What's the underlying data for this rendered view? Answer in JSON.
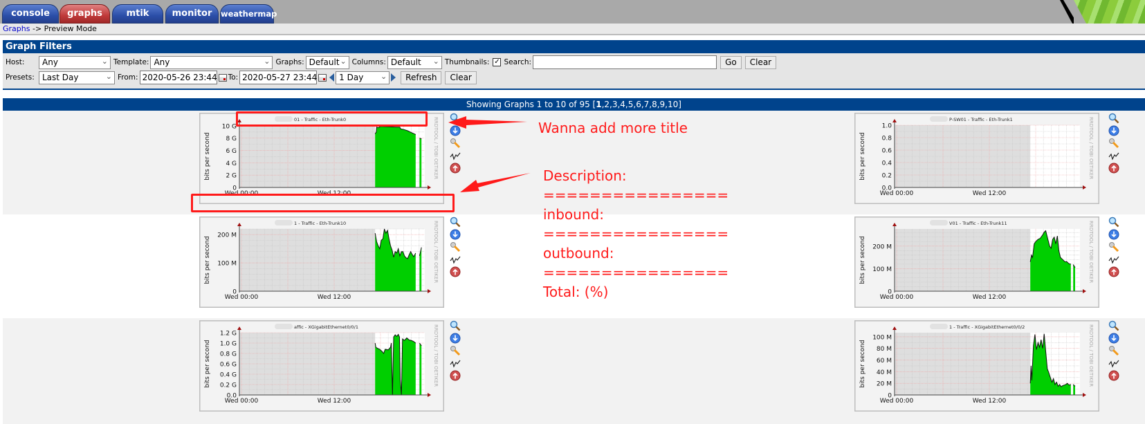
{
  "tabs": [
    {
      "label": "console",
      "active": false
    },
    {
      "label": "graphs",
      "active": true
    },
    {
      "label": "mtik",
      "active": false
    },
    {
      "label": "monitor",
      "active": false
    },
    {
      "label": "weathermap",
      "active": false
    }
  ],
  "breadcrumb": {
    "link": "Graphs",
    "rest": " -> Preview Mode"
  },
  "filters": {
    "title": "Graph Filters",
    "host_label": "Host:",
    "host": "Any",
    "template_label": "Template:",
    "template": "Any",
    "graphs_label": "Graphs:",
    "graphs": "Default",
    "columns_label": "Columns:",
    "columns": "Default",
    "thumbnails_label": "Thumbnails:",
    "thumbnails_checked": true,
    "search_label": "Search:",
    "search_value": "",
    "go": "Go",
    "clear": "Clear",
    "presets_label": "Presets:",
    "preset": "Last Day",
    "from_label": "From:",
    "from": "2020-05-26 23:44",
    "to_label": "To:",
    "to": "2020-05-27 23:44",
    "span": "1 Day",
    "refresh": "Refresh",
    "clear2": "Clear"
  },
  "showing": {
    "text": "Showing Graphs 1 to 10 of 95 [",
    "current": "1",
    "pages": ",2,3,4,5,6,7,8,9,10]"
  },
  "graph_common": {
    "ylabel": "bits per second",
    "watermark": "RRDTOOL / TOBI OETIKER",
    "xticks": [
      {
        "h": 0,
        "label": "Wed 00:00"
      },
      {
        "h": 12,
        "label": "Wed 12:00"
      }
    ],
    "range_hours": [
      -0.27,
      23.73
    ],
    "unknown_until": 17.3,
    "area_color": "#00cf00"
  },
  "graphs": [
    {
      "title": "01 - Traffic - Eth-Trunk0",
      "ymax": 10.1,
      "yticks": [
        [
          0,
          "0"
        ],
        [
          2,
          "2 G"
        ],
        [
          4,
          "4 G"
        ],
        [
          6,
          "6 G"
        ],
        [
          8,
          "8 G"
        ],
        [
          10,
          "10 G"
        ]
      ],
      "minor": 1,
      "series": [
        [
          [
            17.3,
            8.7
          ],
          [
            17.45,
            9.0
          ],
          [
            17.5,
            9.8
          ],
          [
            17.7,
            9.7
          ],
          [
            18,
            9.9
          ],
          [
            19,
            9.85
          ],
          [
            20,
            9.8
          ],
          [
            20.5,
            9.8
          ],
          [
            20.6,
            9.5
          ],
          [
            21,
            9.4
          ],
          [
            21.5,
            9.2
          ],
          [
            22,
            8.9
          ],
          [
            22.55,
            8.6
          ]
        ],
        [
          [
            23.05,
            8.0
          ],
          [
            23.3,
            7.9
          ]
        ]
      ]
    },
    {
      "title": "P-SW01 - Traffic - Eth-Trunk1",
      "ymax": 1.0,
      "yticks": [
        [
          0,
          "0.0"
        ],
        [
          0.2,
          "0.2"
        ],
        [
          0.4,
          "0.4"
        ],
        [
          0.6,
          "0.6"
        ],
        [
          0.8,
          "0.8"
        ],
        [
          1.0,
          "1.0"
        ]
      ],
      "minor": 0.1,
      "series": []
    },
    {
      "title": "1 - Traffic - Eth-Trunk10",
      "ymax": 220,
      "yticks": [
        [
          0,
          "0"
        ],
        [
          100,
          "100 M"
        ],
        [
          200,
          "200 M"
        ]
      ],
      "minor": 20,
      "series": [
        [
          [
            17.3,
            205
          ],
          [
            17.5,
            175
          ],
          [
            17.7,
            160
          ],
          [
            17.9,
            150
          ],
          [
            18.1,
            180
          ],
          [
            18.3,
            185
          ],
          [
            18.5,
            220
          ],
          [
            18.7,
            205
          ],
          [
            18.9,
            215
          ],
          [
            19.1,
            185
          ],
          [
            19.3,
            160
          ],
          [
            19.5,
            145
          ],
          [
            19.7,
            120
          ],
          [
            19.9,
            140
          ],
          [
            20.1,
            135
          ],
          [
            20.3,
            150
          ],
          [
            20.5,
            125
          ],
          [
            20.7,
            140
          ],
          [
            20.9,
            140
          ],
          [
            21.1,
            125
          ],
          [
            21.3,
            118
          ],
          [
            21.5,
            115
          ],
          [
            21.7,
            128
          ],
          [
            21.9,
            140
          ],
          [
            22.1,
            130
          ],
          [
            22.3,
            122
          ],
          [
            22.55,
            135
          ]
        ],
        [
          [
            23.05,
            125
          ],
          [
            23.3,
            155
          ]
        ]
      ]
    },
    {
      "title": "V01 - Traffic - Eth-Trunk11",
      "ymax": 276,
      "yticks": [
        [
          0,
          "0"
        ],
        [
          100,
          "100 M"
        ],
        [
          200,
          "200 M"
        ]
      ],
      "minor": 20,
      "series": [
        [
          [
            17.3,
            130
          ],
          [
            17.45,
            160
          ],
          [
            17.6,
            150
          ],
          [
            17.8,
            210
          ],
          [
            18.0,
            220
          ],
          [
            18.3,
            230
          ],
          [
            18.6,
            235
          ],
          [
            18.9,
            250
          ],
          [
            19.1,
            262
          ],
          [
            19.3,
            268
          ],
          [
            19.5,
            240
          ],
          [
            19.8,
            200
          ],
          [
            20.0,
            190
          ],
          [
            20.2,
            230
          ],
          [
            20.4,
            240
          ],
          [
            20.6,
            210
          ],
          [
            20.8,
            245
          ],
          [
            21.0,
            180
          ],
          [
            21.2,
            150
          ],
          [
            21.5,
            140
          ],
          [
            21.8,
            130
          ],
          [
            22.0,
            132
          ],
          [
            22.3,
            122
          ],
          [
            22.55,
            120
          ]
        ],
        [
          [
            22.85,
            118
          ],
          [
            23.1,
            105
          ]
        ]
      ]
    },
    {
      "title": "affic - XGigabitEthernet0/0/1",
      "ymax": 1.2,
      "yticks": [
        [
          0,
          "0.0"
        ],
        [
          0.2,
          "0.2 G"
        ],
        [
          0.4,
          "0.4 G"
        ],
        [
          0.6,
          "0.6 G"
        ],
        [
          0.8,
          "0.8 G"
        ],
        [
          1.0,
          "1.0 G"
        ],
        [
          1.2,
          "1.2 G"
        ]
      ],
      "minor": 0.1,
      "series": [
        [
          [
            17.3,
            1.0
          ],
          [
            17.4,
            0.92
          ],
          [
            17.6,
            0.9
          ],
          [
            17.9,
            0.88
          ],
          [
            18.2,
            0.84
          ],
          [
            18.4,
            0.8
          ],
          [
            18.6,
            0.88
          ],
          [
            19.0,
            0.87
          ],
          [
            19.3,
            0.92
          ],
          [
            19.4,
            1.0
          ],
          [
            19.55,
            0.0
          ],
          [
            19.7,
            1.12
          ],
          [
            19.9,
            1.16
          ],
          [
            20.1,
            1.13
          ],
          [
            20.3,
            1.17
          ],
          [
            20.45,
            1.12
          ],
          [
            20.55,
            0.3
          ],
          [
            20.7,
            0.0
          ],
          [
            20.85,
            1.08
          ],
          [
            21.1,
            1.05
          ],
          [
            21.4,
            1.1
          ],
          [
            21.7,
            1.06
          ],
          [
            22.0,
            1.05
          ],
          [
            22.3,
            1.03
          ],
          [
            22.55,
            1.0
          ]
        ],
        [
          [
            23.05,
            1.0
          ],
          [
            23.3,
            0.95
          ]
        ]
      ]
    },
    {
      "title": "1 - Traffic - XGigabitEthernet0/0/2",
      "ymax": 107,
      "yticks": [
        [
          0,
          "0"
        ],
        [
          20,
          "20 M"
        ],
        [
          40,
          "40 M"
        ],
        [
          60,
          "60 M"
        ],
        [
          80,
          "80 M"
        ],
        [
          100,
          "100 M"
        ]
      ],
      "minor": 10,
      "series": [
        [
          [
            17.3,
            20
          ],
          [
            17.4,
            50
          ],
          [
            17.5,
            25
          ],
          [
            17.7,
            85
          ],
          [
            17.9,
            104
          ],
          [
            18.1,
            78
          ],
          [
            18.3,
            90
          ],
          [
            18.5,
            82
          ],
          [
            18.7,
            95
          ],
          [
            18.9,
            80
          ],
          [
            19.1,
            105
          ],
          [
            19.3,
            75
          ],
          [
            19.5,
            45
          ],
          [
            19.7,
            38
          ],
          [
            19.9,
            30
          ],
          [
            20.1,
            22
          ],
          [
            20.3,
            28
          ],
          [
            20.5,
            18
          ],
          [
            20.7,
            22
          ],
          [
            20.9,
            15
          ],
          [
            21.1,
            18
          ],
          [
            21.3,
            14
          ],
          [
            21.5,
            16
          ],
          [
            21.7,
            17
          ],
          [
            21.9,
            18
          ],
          [
            22.1,
            20
          ],
          [
            22.3,
            17
          ],
          [
            22.55,
            18
          ]
        ],
        [
          [
            22.85,
            18
          ],
          [
            23.1,
            15
          ]
        ]
      ]
    }
  ],
  "annotations": {
    "title_note": "Wanna add more title",
    "lines": [
      "Description:",
      "================",
      "inbound:",
      "================",
      "outbound:",
      "================",
      "Total: (%)"
    ],
    "color": "#ff1a1a"
  }
}
